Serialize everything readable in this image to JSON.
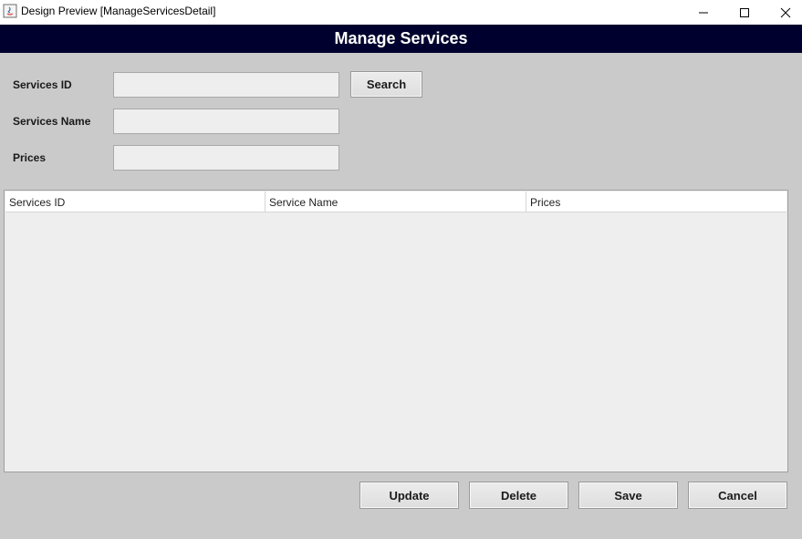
{
  "window": {
    "title": "Design Preview [ManageServicesDetail]"
  },
  "banner": {
    "title": "Manage Services",
    "background": "#00002e"
  },
  "form": {
    "services_id": {
      "label": "Services ID",
      "value": ""
    },
    "services_name": {
      "label": "Services Name",
      "value": ""
    },
    "prices": {
      "label": "Prices",
      "value": ""
    },
    "search_label": "Search"
  },
  "table": {
    "columns": [
      "Services ID",
      "Service Name",
      "Prices"
    ],
    "rows": []
  },
  "actions": {
    "update_label": "Update",
    "delete_label": "Delete",
    "save_label": "Save",
    "cancel_label": "Cancel"
  }
}
